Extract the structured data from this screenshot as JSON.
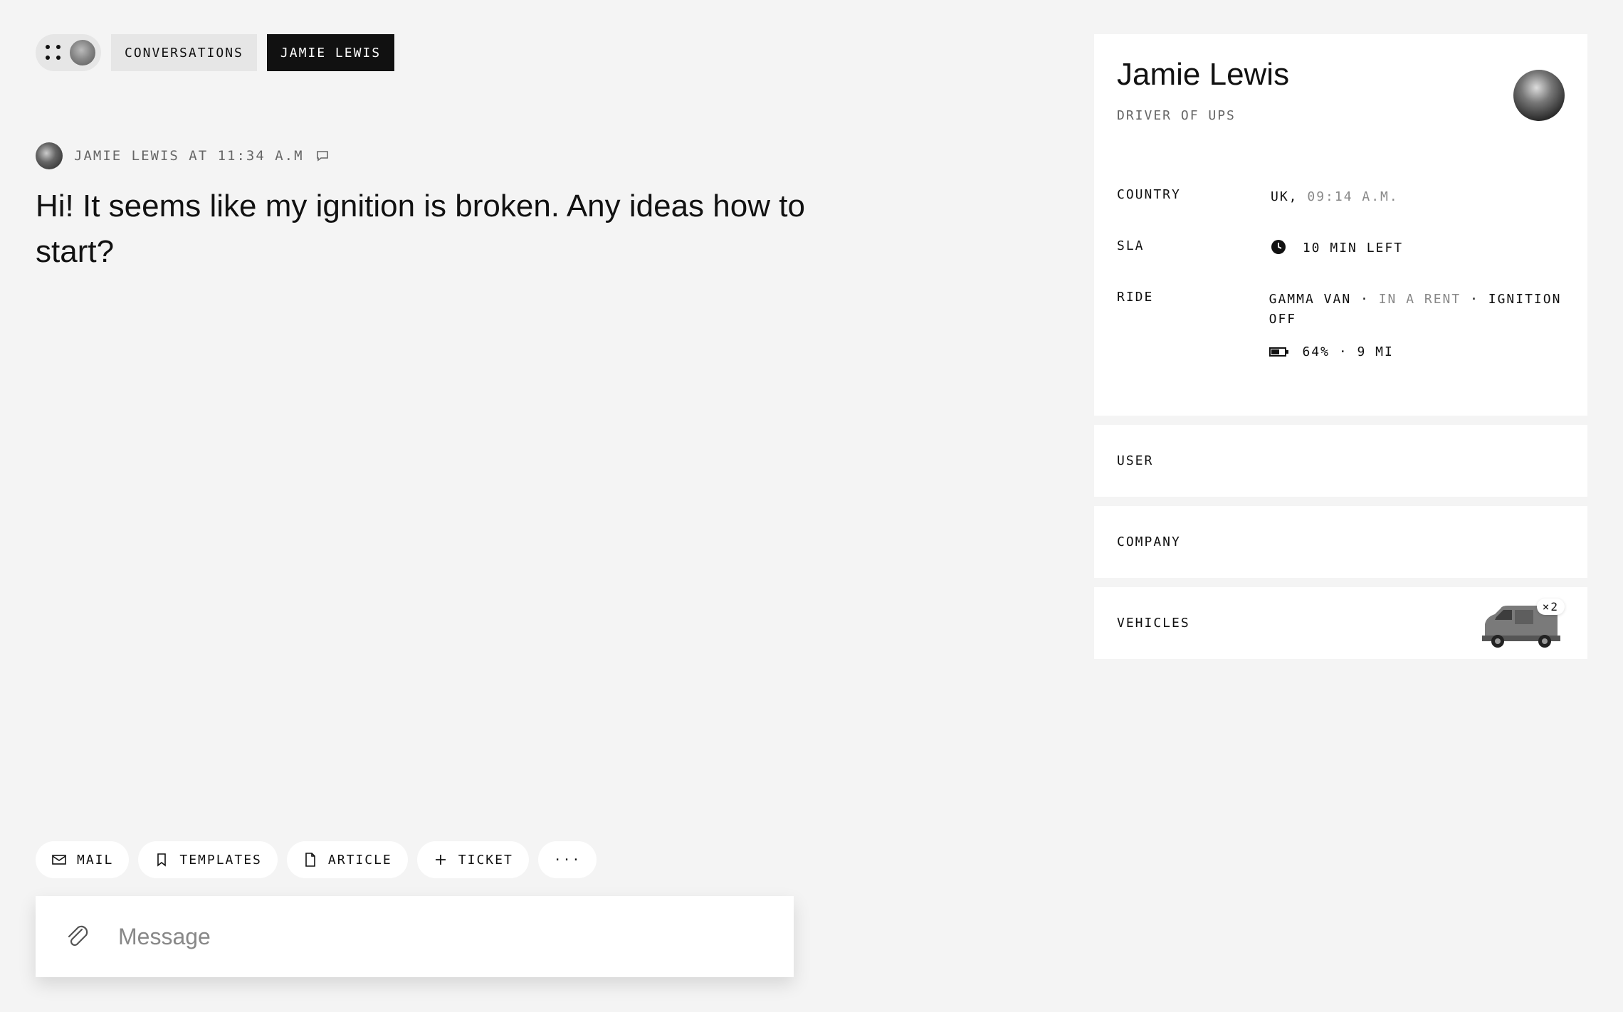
{
  "nav": {
    "crumb_conversations": "CONVERSATIONS",
    "crumb_current": "JAMIE LEWIS"
  },
  "message": {
    "meta": "JAMIE LEWIS AT 11:34 A.M",
    "text": "Hi! It seems like my ignition is broken. Any ideas how to start?"
  },
  "actions": {
    "mail": "MAIL",
    "templates": "TEMPLATES",
    "article": "ARTICLE",
    "ticket": "TICKET",
    "more": "···"
  },
  "composer": {
    "placeholder": "Message"
  },
  "profile": {
    "name": "Jamie Lewis",
    "role": "DRIVER OF UPS",
    "country_label": "COUNTRY",
    "country_value": "UK,",
    "country_time": "09:14 A.M.",
    "sla_label": "SLA",
    "sla_value": "10 MIN LEFT",
    "ride_label": "RIDE",
    "ride_vehicle": "GAMMA VAN ·",
    "ride_status": "IN A RENT",
    "ride_ignition": "· IGNITION OFF",
    "ride_battery": "64% · 9 MI"
  },
  "sections": {
    "user": "USER",
    "company": "COMPANY",
    "vehicles": "VEHICLES",
    "vehicles_count": "×2"
  },
  "icons": [
    "grid-icon",
    "comment-icon",
    "mail-icon",
    "bookmark-icon",
    "file-icon",
    "plus-icon",
    "paperclip-icon",
    "clock-icon",
    "battery-icon",
    "van-image"
  ],
  "colors": {
    "background": "#f4f4f4",
    "panel": "#ffffff",
    "accent_dark": "#111111",
    "muted": "#888888"
  }
}
